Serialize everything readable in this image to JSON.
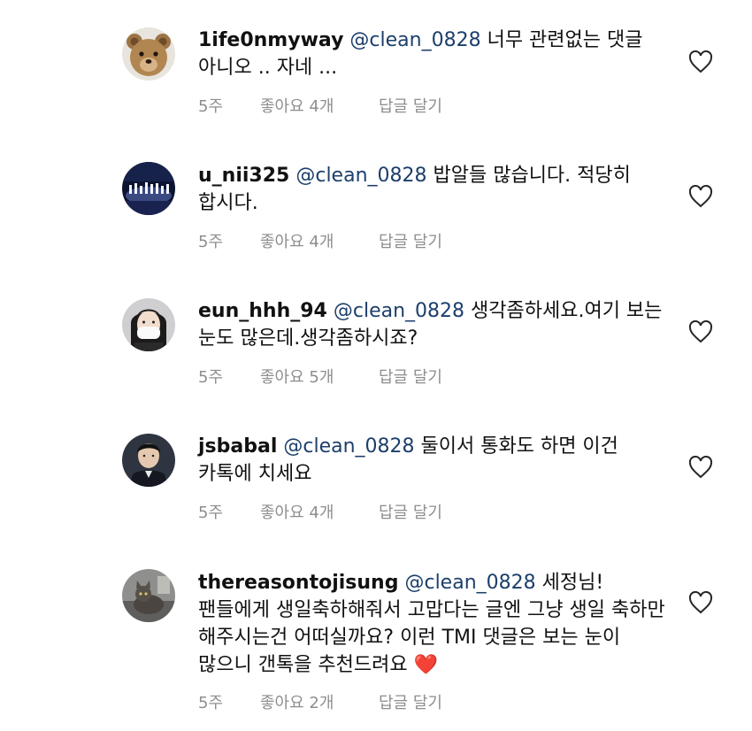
{
  "comments": [
    {
      "username": "1ife0nmyway",
      "mention": "@clean_0828",
      "text": "너무 관련없는 댓글 아니오 .. 자네 ...",
      "time": "5주",
      "likes": "좋아요 4개",
      "reply": "답글 달기",
      "avatar": "teddy-bear"
    },
    {
      "username": "u_nii325",
      "mention": "@clean_0828",
      "text": "밥알들 많습니다. 적당히 합시다.",
      "time": "5주",
      "likes": "좋아요 4개",
      "reply": "답글 달기",
      "avatar": "concert-stage"
    },
    {
      "username": "eun_hhh_94",
      "mention": "@clean_0828",
      "text": "생각좀하세요.여기 보는 눈도 많은데.생각좀하시죠?",
      "time": "5주",
      "likes": "좋아요 5개",
      "reply": "답글 달기",
      "avatar": "masked-person"
    },
    {
      "username": "jsbabal",
      "mention": "@clean_0828",
      "text": "둘이서 통화도 하면 이건 카톡에 치세요",
      "time": "5주",
      "likes": "좋아요 4개",
      "reply": "답글 달기",
      "avatar": "man-portrait"
    },
    {
      "username": "thereasontojisung",
      "mention": "@clean_0828",
      "text": "세정님! 팬들에게 생일축하해줘서 고맙다는 글엔 그냥 생일 축하만 해주시는건 어떠실까요? 이런 TMI 댓글은 보는 눈이 많으니 갠톡을 추천드려요",
      "emoji": "❤️",
      "time": "5주",
      "likes": "좋아요 2개",
      "reply": "답글 달기",
      "avatar": "cat-photo"
    }
  ],
  "colors": {
    "mention": "#1c3f6b",
    "meta": "#8e8e8e",
    "heart_emoji": "#e0222a"
  }
}
